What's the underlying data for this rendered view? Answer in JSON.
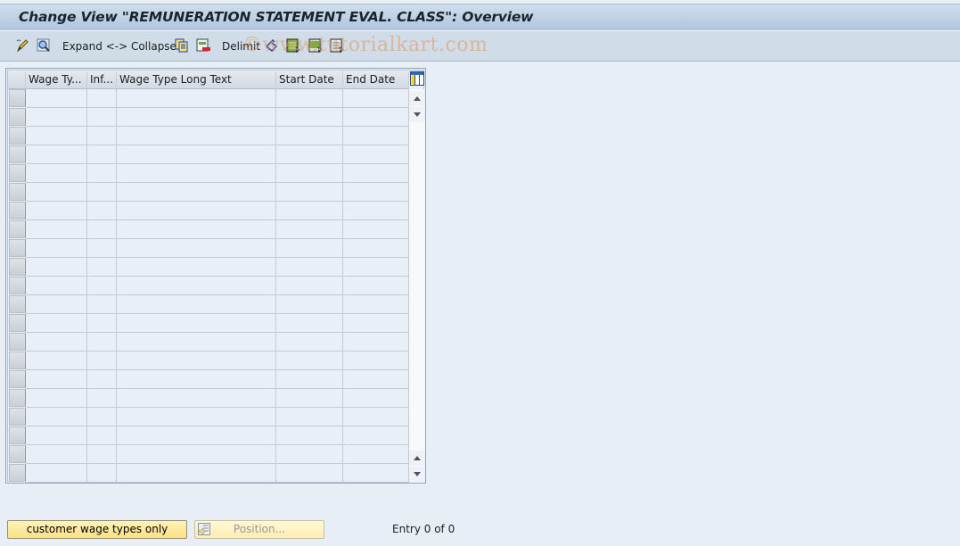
{
  "window": {
    "title": "Change View \"REMUNERATION STATEMENT EVAL. CLASS\": Overview"
  },
  "toolbar": {
    "items": [
      {
        "name": "change-display-icon",
        "label": ""
      },
      {
        "name": "find-icon",
        "label": ""
      },
      {
        "name": "expand-collapse-button",
        "label": "Expand <-> Collapse"
      },
      {
        "name": "copy-as-icon",
        "label": ""
      },
      {
        "name": "delete-icon",
        "label": ""
      },
      {
        "name": "delimit-button",
        "label": "Delimit"
      },
      {
        "name": "undo-change-icon",
        "label": ""
      },
      {
        "name": "select-all-icon",
        "label": ""
      },
      {
        "name": "select-block-icon",
        "label": ""
      },
      {
        "name": "deselect-all-icon",
        "label": ""
      }
    ],
    "watermark": "©www.tutorialkart.com"
  },
  "table": {
    "columns": [
      {
        "key": "wage_type",
        "label": "Wage Ty..."
      },
      {
        "key": "inf",
        "label": "Inf..."
      },
      {
        "key": "long_text",
        "label": "Wage Type Long Text"
      },
      {
        "key": "start_date",
        "label": "Start Date"
      },
      {
        "key": "end_date",
        "label": "End Date"
      }
    ],
    "rows": [],
    "visible_empty_rows": 21,
    "scroll_position": 0
  },
  "footer": {
    "customer_button": "customer wage types only",
    "position_button": "Position...",
    "entry_status": "Entry 0 of 0"
  },
  "colors": {
    "background": "#e8eef6",
    "title_bar": "#b0c6dd",
    "toolbar": "#d0dde8",
    "button_yellow": "#fbe189"
  }
}
